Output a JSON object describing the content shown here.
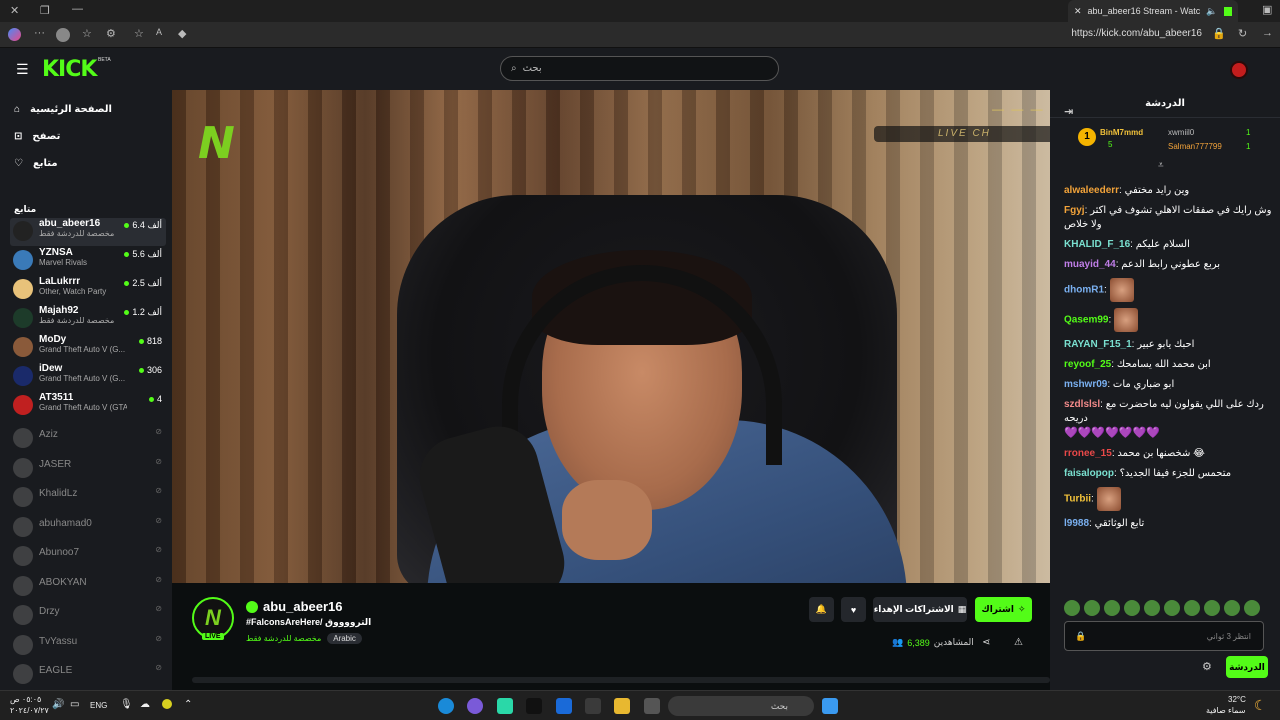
{
  "browser": {
    "tab_title": "abu_abeer16 Stream - Watc",
    "url": "https://kick.com/abu_abeer16"
  },
  "header": {
    "logo": "KICK",
    "beta": "BETA",
    "search_placeholder": "بحث"
  },
  "sidebar": {
    "nav": [
      {
        "label": "الصفحة الرئيسية",
        "icon": "home-icon"
      },
      {
        "label": "تصفح",
        "icon": "compass-icon"
      },
      {
        "label": "متابع",
        "icon": "heart-icon"
      }
    ],
    "following_label": "متابع",
    "live_channels": [
      {
        "name": "abu_abeer16",
        "sub": "مخصصة للدردشة فقط",
        "viewers": "ألف 6.4",
        "color": "#222"
      },
      {
        "name": "YZNSA",
        "sub": "Marvel Rivals",
        "viewers": "ألف 5.6",
        "color": "#3a7ab8"
      },
      {
        "name": "LaLukrrr",
        "sub": "Other, Watch Party",
        "viewers": "ألف 2.5",
        "color": "#e8c27a"
      },
      {
        "name": "Majah92",
        "sub": "مخصصة للدردشة فقط",
        "viewers": "ألف 1.2",
        "color": "#1d3b2a"
      },
      {
        "name": "MoDy",
        "sub": "Grand Theft Auto V (G...",
        "viewers": "818",
        "color": "#8a5a3a"
      },
      {
        "name": "iDew",
        "sub": "Grand Theft Auto V (G...",
        "viewers": "306",
        "color": "#1a2a6a"
      },
      {
        "name": "AT3511",
        "sub": "Grand Theft Auto V (GTA)",
        "viewers": "4",
        "color": "#c02020"
      }
    ],
    "offline_channels": [
      "Aziz",
      "JASER",
      "KhalidLz",
      "abuhamad0",
      "Abunoo7",
      "ABOKYAN",
      "Drzy",
      "TvYassu",
      "EAGLE"
    ]
  },
  "video": {
    "watermark": "N",
    "live_chip": "LIVE CH",
    "dashes": "— — —"
  },
  "stream": {
    "live_badge": "LIVE",
    "name": "abu_abeer16",
    "title": "#FalconsAreHere/ الترووووق",
    "category": "مخصصة للدردشة فقط",
    "language": "Arabic",
    "subscribe_label": "اشتراك",
    "gift_label": "الاشتراكات الإهداء",
    "viewers_label": "المشاهدين",
    "viewers_count": "6,389"
  },
  "chat": {
    "title": "الدردشة",
    "gifters": {
      "top": {
        "rank": "1",
        "name": "BinM7mmd",
        "count": "5"
      },
      "others": [
        {
          "name": "xwmiil0",
          "count": "1"
        },
        {
          "name": "Salman777799",
          "count": "1"
        }
      ]
    },
    "messages": [
      {
        "user": "alwaleederr",
        "color": "#f2a33a",
        "text": "وين رايد مختفي"
      },
      {
        "user": "Fgyj",
        "color": "#f2a33a",
        "text": "وش رايك في صفقات الاهلي تشوف في اكثر ولا خلاص"
      },
      {
        "user": "KHALID_F_16",
        "color": "#7ae0d0",
        "text": "السلام عليكم"
      },
      {
        "user": "muayid_44",
        "color": "#c07ee8",
        "text": "بربع عطوني رابط الدعم"
      },
      {
        "user": "dhomR1",
        "color": "#7ab0f0",
        "text": ""
      },
      {
        "user": "Qasem99",
        "color": "#53fc18",
        "text": ""
      },
      {
        "user": "RAYAN_F15_1",
        "color": "#7ae0d0",
        "text": "احبك يابو عبير"
      },
      {
        "user": "reyoof_25",
        "color": "#53fc18",
        "text": "ابن محمد الله يسامحك"
      },
      {
        "user": "mshwr09",
        "color": "#7ab0f0",
        "text": "ابو ضباري مات"
      },
      {
        "user": "szdlslsl",
        "color": "#f28a8a",
        "text": "ردك على اللي يقولون ليه ماحضرت مع دريحه"
      },
      {
        "user": "rronee_15",
        "color": "#e84848",
        "text": "شخصنها بن محمد"
      },
      {
        "user": "faisalopop",
        "color": "#7ae0d0",
        "text": "متحمس للجزء فيفا الجديد؟"
      },
      {
        "user": "Turbii",
        "color": "#f2c23a",
        "text": ""
      },
      {
        "user": "l9988",
        "color": "#7ab0f0",
        "text": "تابع الوثائقي"
      }
    ],
    "input_placeholder": "انتظر 3 ثواني",
    "send_label": "الدردشة"
  },
  "taskbar": {
    "time": "٠٥:٠٥ ص",
    "date": "٢٠٢٤/٠٧/٢٧",
    "lang": "ENG",
    "search": "بحث",
    "weather_temp": "32°C",
    "weather_desc": "سماء صافية"
  }
}
